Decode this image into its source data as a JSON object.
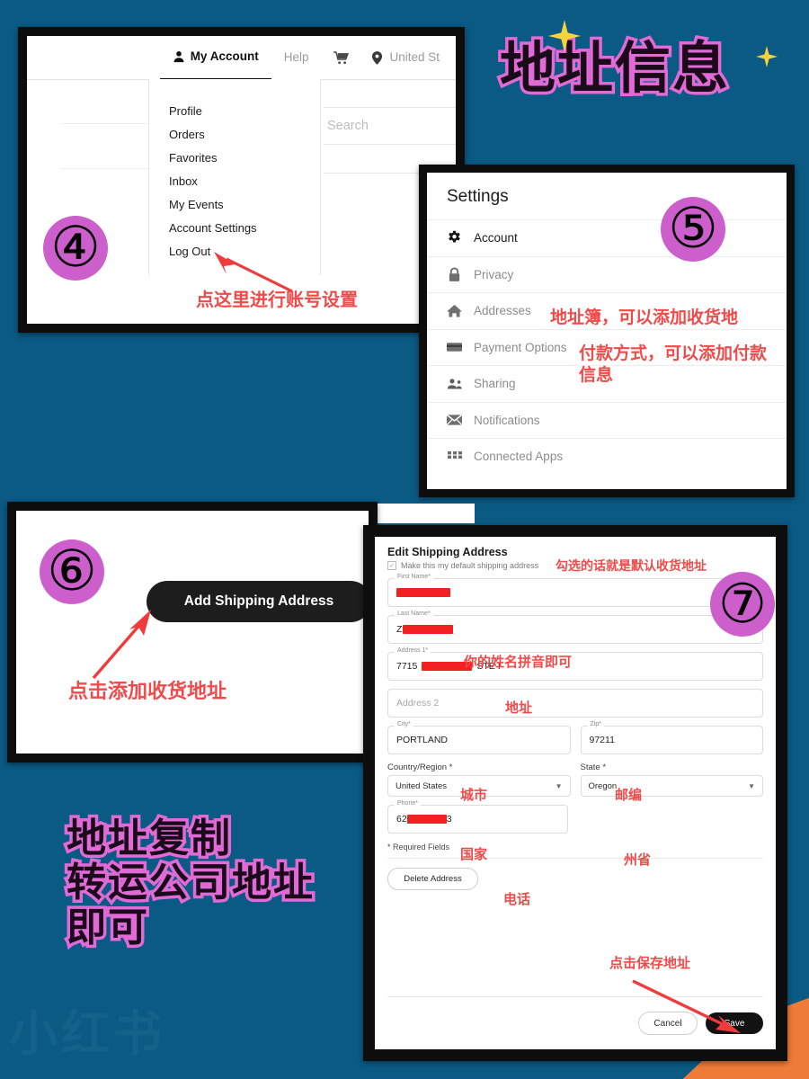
{
  "background": {
    "color": "#0a5a84",
    "accent_orange": "#ef7b38",
    "badge_pink": "#cc5fcc",
    "annotation_red": "#f04a4a",
    "title_outline_pink": "#e06ad6",
    "watermark": "小红书"
  },
  "titles": {
    "main": "地址信息",
    "bottom_left": "地址复制\n转运公司地址\n即可"
  },
  "badges": {
    "step4": "④",
    "step5": "⑤",
    "step6": "⑥",
    "step7": "⑦"
  },
  "panel4": {
    "nav": [
      {
        "label": "My Account",
        "icon": "person-icon",
        "active": true
      },
      {
        "label": "Help",
        "icon": "",
        "active": false
      },
      {
        "label": "",
        "icon": "cart-icon",
        "active": false
      },
      {
        "label": "United St",
        "icon": "location-pin-icon",
        "active": false
      }
    ],
    "menu_items": [
      "Profile",
      "Orders",
      "Favorites",
      "Inbox",
      "My Events",
      "Account Settings",
      "Log Out"
    ],
    "search_placeholder": "Search",
    "annotation": "点这里进行账号设置"
  },
  "panel5": {
    "title": "Settings",
    "items": [
      {
        "label": "Account",
        "icon": "gear-icon",
        "active": true
      },
      {
        "label": "Privacy",
        "icon": "lock-icon",
        "active": false
      },
      {
        "label": "Addresses",
        "icon": "home-icon",
        "active": false
      },
      {
        "label": "Payment Options",
        "icon": "credit-card-icon",
        "active": false
      },
      {
        "label": "Sharing",
        "icon": "people-icon",
        "active": false
      },
      {
        "label": "Notifications",
        "icon": "envelope-icon",
        "active": false
      },
      {
        "label": "Connected Apps",
        "icon": "grid-icon",
        "active": false
      }
    ],
    "annotations": {
      "addresses": "地址簿，可以添加收货地",
      "payment": "付款方式，可以添加付款\n信息"
    }
  },
  "panel6": {
    "button_label": "Add Shipping Address",
    "annotation": "点击添加收货地址"
  },
  "panel7": {
    "heading": "Edit Shipping Address",
    "default_checkbox_label": "Make this my default shipping address",
    "default_checkbox_checked": true,
    "fields": [
      {
        "label": "First Name*",
        "value": "",
        "redacted": true,
        "placeholder": ""
      },
      {
        "label": "Last Name*",
        "value": "Z",
        "redacted": true,
        "placeholder": ""
      },
      {
        "label": "Address 1*",
        "value": "7715",
        "suffix": "STE I",
        "redacted": true,
        "placeholder": ""
      },
      {
        "label": "",
        "value": "",
        "redacted": false,
        "placeholder": "Address 2"
      }
    ],
    "city": {
      "label": "City*",
      "value": "PORTLAND"
    },
    "zip": {
      "label": "Zip*",
      "value": "97211"
    },
    "country": {
      "label": "Country/Region *",
      "value": "United States"
    },
    "state": {
      "label": "State *",
      "value": "Oregon"
    },
    "phone": {
      "label": "Phone*",
      "value": "62",
      "suffix": "3",
      "redacted": true
    },
    "required_note": "* Required Fields",
    "delete_label": "Delete Address",
    "cancel_label": "Cancel",
    "save_label": "Save",
    "annotations": {
      "default": "勾选的话就是默认收货地址",
      "name": "你的姓名拼音即可",
      "address": "地址",
      "city": "城市",
      "zip": "邮编",
      "country": "国家",
      "state": "州省",
      "phone": "电话",
      "save": "点击保存地址"
    }
  }
}
